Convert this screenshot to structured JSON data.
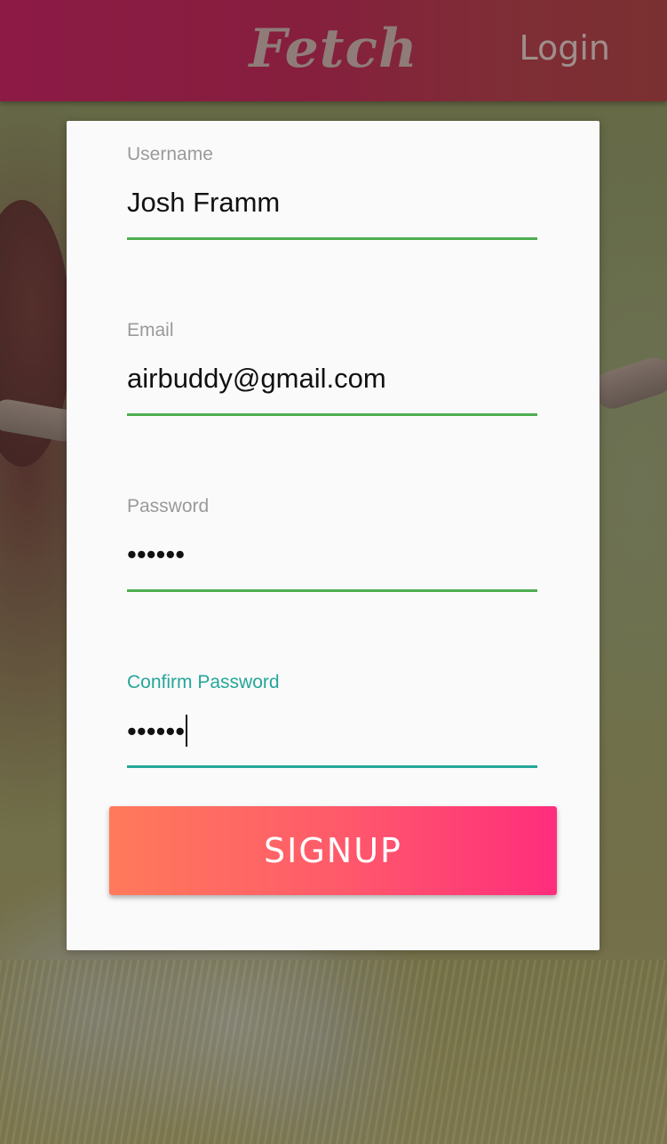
{
  "header": {
    "logo": "Fetch",
    "login_label": "Login"
  },
  "form": {
    "username": {
      "label": "Username",
      "value": "Josh Framm"
    },
    "email": {
      "label": "Email",
      "value": "airbuddy@gmail.com"
    },
    "password": {
      "label": "Password",
      "value": "••••••"
    },
    "confirm_password": {
      "label": "Confirm Password",
      "value": "••••••"
    },
    "signup_label": "SIGNUP"
  },
  "colors": {
    "header_start": "#8c1a45",
    "header_end": "#7a3030",
    "valid_underline": "#4caf50",
    "focused_accent": "#26a69a",
    "button_start": "#ff7a5a",
    "button_end": "#ff2d7c"
  }
}
